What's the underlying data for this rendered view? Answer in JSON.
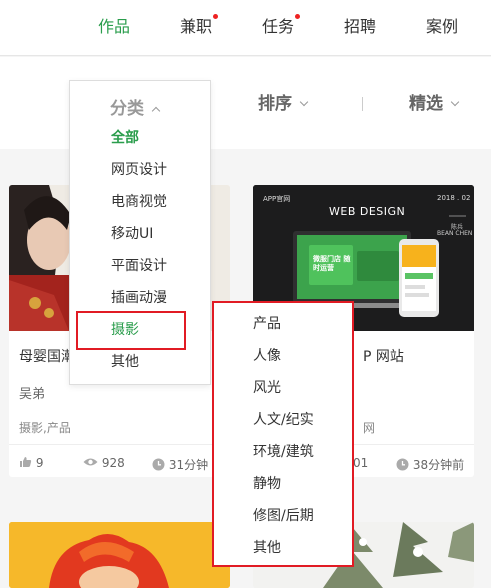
{
  "nav": {
    "items": [
      {
        "label": "作品",
        "active": true,
        "dot": false
      },
      {
        "label": "兼职",
        "active": false,
        "dot": true
      },
      {
        "label": "任务",
        "active": false,
        "dot": true
      },
      {
        "label": "招聘",
        "active": false,
        "dot": false
      },
      {
        "label": "案例",
        "active": false,
        "dot": false
      }
    ],
    "accent_color": "#2a9d4c",
    "dot_color": "#ee2222"
  },
  "filters": {
    "category": "分类",
    "sort": "排序",
    "featured": "精选"
  },
  "category_menu": {
    "items": [
      "全部",
      "网页设计",
      "电商视觉",
      "移动UI",
      "平面设计",
      "插画动漫",
      "摄影",
      "其他"
    ],
    "active": "全部",
    "highlighted": "摄影",
    "highlight_color": "#e11b24"
  },
  "subcategory_menu": {
    "items": [
      "产品",
      "人像",
      "风光",
      "人文/纪实",
      "环境/建筑",
      "静物",
      "修图/后期",
      "其他"
    ]
  },
  "cards": [
    {
      "title": "母婴国潮",
      "author": "吴弟",
      "tags": "摄影,产品",
      "likes": "9",
      "views": "928",
      "time": "31分钟"
    },
    {
      "title": "P 网站",
      "tags": "网",
      "views": "01",
      "time": "38分钟前",
      "image_text": {
        "brand": "APP官网",
        "date": "2018 . 02",
        "headline": "WEB DESIGN",
        "author_cn": "陈兵",
        "author_en": "BEAN CHEN",
        "screen_text": "微服门店 随时运营"
      }
    }
  ]
}
